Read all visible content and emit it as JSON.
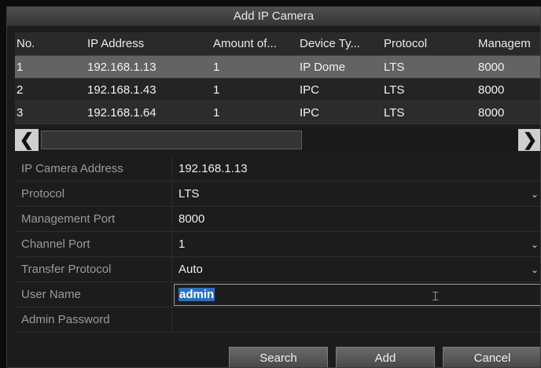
{
  "dialog": {
    "title": "Add IP Camera"
  },
  "table": {
    "headers": [
      "No.",
      "IP Address",
      "Amount of...",
      "Device Ty...",
      "Protocol",
      "Managem"
    ],
    "rows": [
      {
        "no": "1",
        "ip": "192.168.1.13",
        "amount": "1",
        "device": "IP Dome",
        "protocol": "LTS",
        "port": "8000"
      },
      {
        "no": "2",
        "ip": "192.168.1.43",
        "amount": "1",
        "device": "IPC",
        "protocol": "LTS",
        "port": "8000"
      },
      {
        "no": "3",
        "ip": "192.168.1.64",
        "amount": "1",
        "device": "IPC",
        "protocol": "LTS",
        "port": "8000"
      }
    ],
    "selected_row": 0
  },
  "scrollbar": {
    "left_icon": "chevron-left-icon",
    "right_icon": "chevron-right-icon"
  },
  "form": {
    "ip_camera_address": {
      "label": "IP Camera Address",
      "value": "192.168.1.13"
    },
    "protocol": {
      "label": "Protocol",
      "value": "LTS"
    },
    "management_port": {
      "label": "Management Port",
      "value": "8000"
    },
    "channel_port": {
      "label": "Channel Port",
      "value": "1"
    },
    "transfer_protocol": {
      "label": "Transfer Protocol",
      "value": "Auto"
    },
    "user_name": {
      "label": "User Name",
      "value": "admin"
    },
    "admin_password": {
      "label": "Admin Password",
      "value": ""
    }
  },
  "buttons": {
    "search": "Search",
    "add": "Add",
    "cancel": "Cancel"
  },
  "colors": {
    "selection": "#636363",
    "text_highlight": "#2e6ebd"
  }
}
